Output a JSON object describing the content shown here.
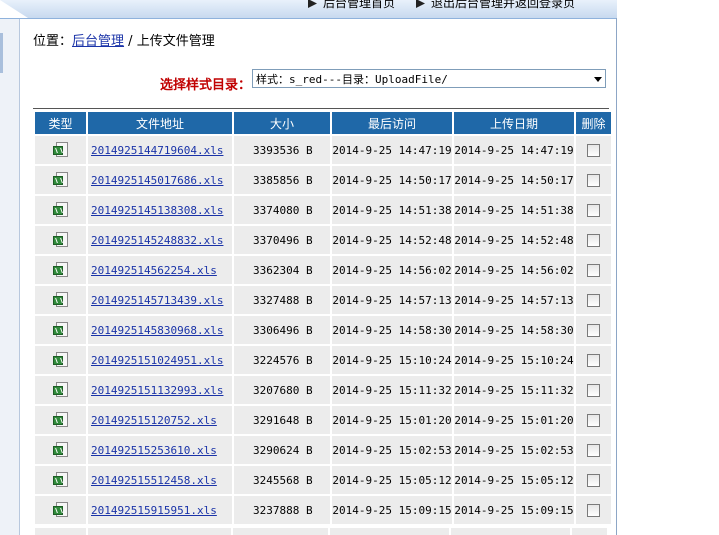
{
  "topbar": {
    "home_label": "后台管理首页",
    "logout_label": "退出后台管理并返回登录页"
  },
  "breadcrumb": {
    "prefix": "位置：",
    "link": "后台管理",
    "separator": "/",
    "current": "上传文件管理"
  },
  "selector": {
    "label": "选择样式目录：",
    "value": "样式：s_red---目录：UploadFile/"
  },
  "table": {
    "headers": {
      "type": "类型",
      "path": "文件地址",
      "size": "大小",
      "last_access": "最后访问",
      "upload_date": "上传日期",
      "delete": "删除"
    },
    "rows": [
      {
        "name": "2014925144719604.xls",
        "size": "3393536 B",
        "access": "2014-9-25 14:47:19",
        "upload": "2014-9-25 14:47:19"
      },
      {
        "name": "2014925145017686.xls",
        "size": "3385856 B",
        "access": "2014-9-25 14:50:17",
        "upload": "2014-9-25 14:50:17"
      },
      {
        "name": "2014925145138308.xls",
        "size": "3374080 B",
        "access": "2014-9-25 14:51:38",
        "upload": "2014-9-25 14:51:38"
      },
      {
        "name": "2014925145248832.xls",
        "size": "3370496 B",
        "access": "2014-9-25 14:52:48",
        "upload": "2014-9-25 14:52:48"
      },
      {
        "name": "201492514562254.xls",
        "size": "3362304 B",
        "access": "2014-9-25 14:56:02",
        "upload": "2014-9-25 14:56:02"
      },
      {
        "name": "2014925145713439.xls",
        "size": "3327488 B",
        "access": "2014-9-25 14:57:13",
        "upload": "2014-9-25 14:57:13"
      },
      {
        "name": "2014925145830968.xls",
        "size": "3306496 B",
        "access": "2014-9-25 14:58:30",
        "upload": "2014-9-25 14:58:30"
      },
      {
        "name": "2014925151024951.xls",
        "size": "3224576 B",
        "access": "2014-9-25 15:10:24",
        "upload": "2014-9-25 15:10:24"
      },
      {
        "name": "2014925151132993.xls",
        "size": "3207680 B",
        "access": "2014-9-25 15:11:32",
        "upload": "2014-9-25 15:11:32"
      },
      {
        "name": "201492515120752.xls",
        "size": "3291648 B",
        "access": "2014-9-25 15:01:20",
        "upload": "2014-9-25 15:01:20"
      },
      {
        "name": "201492515253610.xls",
        "size": "3290624 B",
        "access": "2014-9-25 15:02:53",
        "upload": "2014-9-25 15:02:53"
      },
      {
        "name": "201492515512458.xls",
        "size": "3245568 B",
        "access": "2014-9-25 15:05:12",
        "upload": "2014-9-25 15:05:12"
      },
      {
        "name": "201492515915951.xls",
        "size": "3237888 B",
        "access": "2014-9-25 15:09:15",
        "upload": "2014-9-25 15:09:15"
      }
    ]
  },
  "icons": {
    "file_type": "excel-file-icon",
    "nav_arrow": "arrow-right-icon"
  }
}
